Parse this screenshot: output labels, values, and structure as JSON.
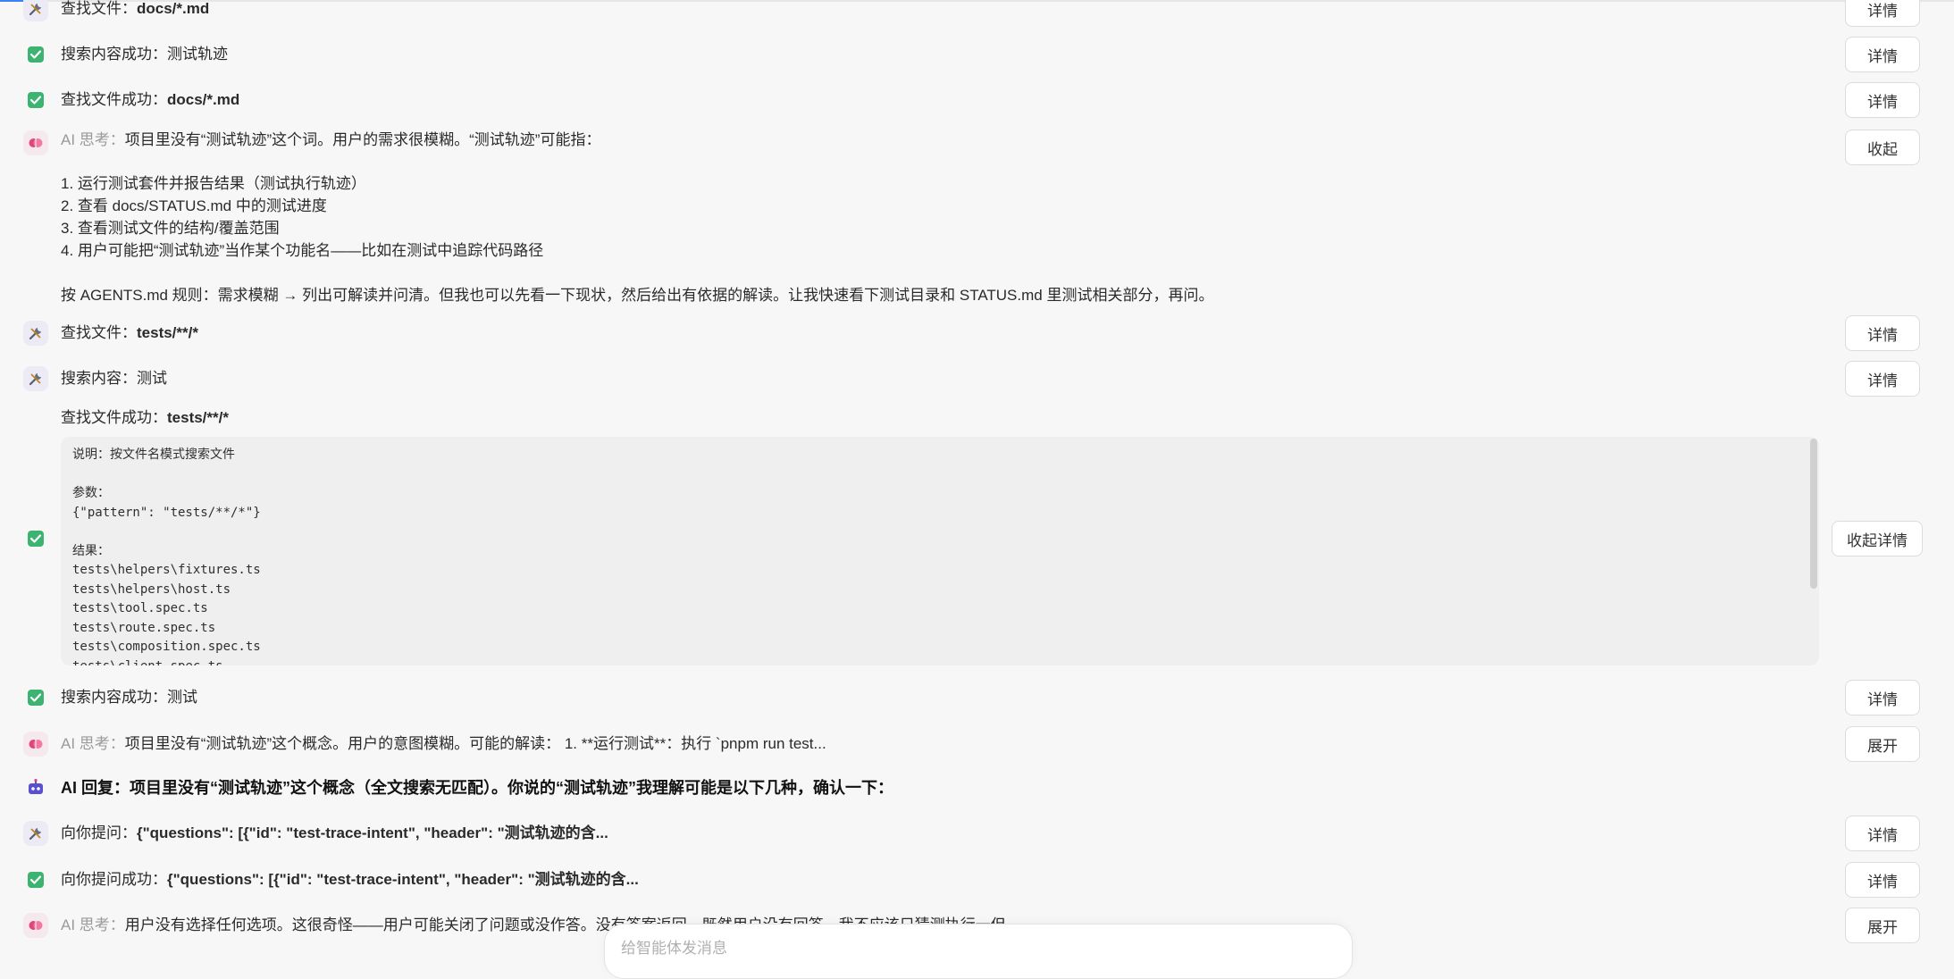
{
  "rows": {
    "r0": {
      "prefix": "查找文件：",
      "value": "docs/*.md",
      "button": "详情"
    },
    "r1": {
      "prefix": "搜索内容成功：",
      "value": "测试轨迹",
      "button": "详情"
    },
    "r2": {
      "prefix": "查找文件成功：",
      "value": "docs/*.md",
      "button": "详情"
    },
    "think1": {
      "prefix": "AI 思考：",
      "text": "项目里没有“测试轨迹”这个词。用户的需求很模糊。“测试轨迹”可能指：",
      "lines": [
        "1. 运行测试套件并报告结果（测试执行轨迹）",
        "2. 查看 docs/STATUS.md 中的测试进度",
        "3. 查看测试文件的结构/覆盖范围",
        "4. 用户可能把“测试轨迹”当作某个功能名——比如在测试中追踪代码路径"
      ],
      "conclusion": "按 AGENTS.md 规则：需求模糊 → 列出可解读并问清。但我也可以先看一下现状，然后给出有依据的解读。让我快速看下测试目录和 STATUS.md 里测试相关部分，再问。",
      "button": "收起"
    },
    "r3": {
      "prefix": "查找文件：",
      "value": "tests/**/*",
      "button": "详情"
    },
    "r4": {
      "prefix": "搜索内容：",
      "value": "测试",
      "button": "详情"
    },
    "r5": {
      "prefix": "查找文件成功：",
      "value": "tests/**/*",
      "code": "说明：按文件名模式搜索文件\n\n参数：\n{\"pattern\": \"tests/**/*\"}\n\n结果：\ntests\\helpers\\fixtures.ts\ntests\\helpers\\host.ts\ntests\\tool.spec.ts\ntests\\route.spec.ts\ntests\\composition.spec.ts\ntests\\client.spec.ts",
      "button": "收起详情"
    },
    "r6": {
      "prefix": "搜索内容成功：",
      "value": "测试",
      "button": "详情"
    },
    "think2": {
      "prefix": "AI 思考：",
      "text": "项目里没有“测试轨迹”这个概念。用户的意图模糊。可能的解读： 1. **运行测试**：执行 `pnpm run test...",
      "button": "展开"
    },
    "reply": {
      "text": "AI 回复：项目里没有“测试轨迹”这个概念（全文搜索无匹配）。你说的“测试轨迹”我理解可能是以下几种，确认一下："
    },
    "r7": {
      "prefix": "向你提问：",
      "value": "{\"questions\": [{\"id\": \"test-trace-intent\", \"header\": \"测试轨迹的含...",
      "button": "详情"
    },
    "r8": {
      "prefix": "向你提问成功：",
      "value": "{\"questions\": [{\"id\": \"test-trace-intent\", \"header\": \"测试轨迹的含...",
      "button": "详情"
    },
    "think3": {
      "prefix": "AI 思考：",
      "text": "用户没有选择任何选项。这很奇怪——用户可能关闭了问题或没作答。没有答案返回，既然用户没有回答，我不应该只猜测执行一但",
      "button": "展开"
    }
  },
  "composer": {
    "placeholder": "给智能体发消息"
  },
  "colors": {
    "accent": "#3b82f6",
    "success": "#3cb371",
    "think": "#e0457b"
  },
  "icons": {
    "tool": "tools-icon",
    "ok": "check-icon",
    "think": "brain-icon",
    "bot": "robot-icon"
  }
}
